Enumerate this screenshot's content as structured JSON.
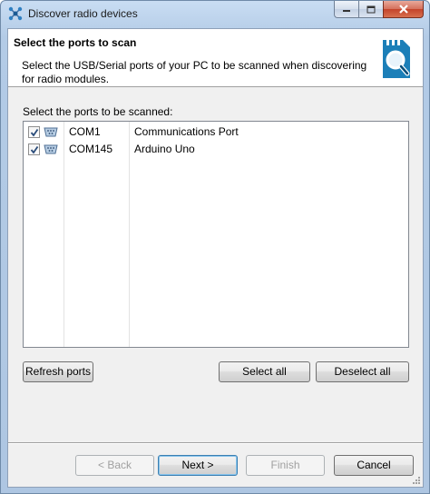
{
  "window": {
    "title": "Discover radio devices"
  },
  "header": {
    "title": "Select the ports to scan",
    "description": "Select the USB/Serial ports of your PC to be scanned when discovering for radio modules."
  },
  "ports": {
    "label": "Select the ports to be scanned:",
    "items": [
      {
        "name": "COM1",
        "description": "Communications Port",
        "checked": true
      },
      {
        "name": "COM145",
        "description": "Arduino Uno",
        "checked": true
      }
    ]
  },
  "buttons": {
    "refresh": "Refresh ports",
    "select_all": "Select all",
    "deselect_all": "Deselect all",
    "back": "< Back",
    "next": "Next >",
    "finish": "Finish",
    "cancel": "Cancel"
  },
  "colors": {
    "title_bar": "#b9d1ea",
    "close_button": "#c7432b",
    "default_button_border": "#3c7fb1",
    "header_icon": "#1c7fb8"
  }
}
